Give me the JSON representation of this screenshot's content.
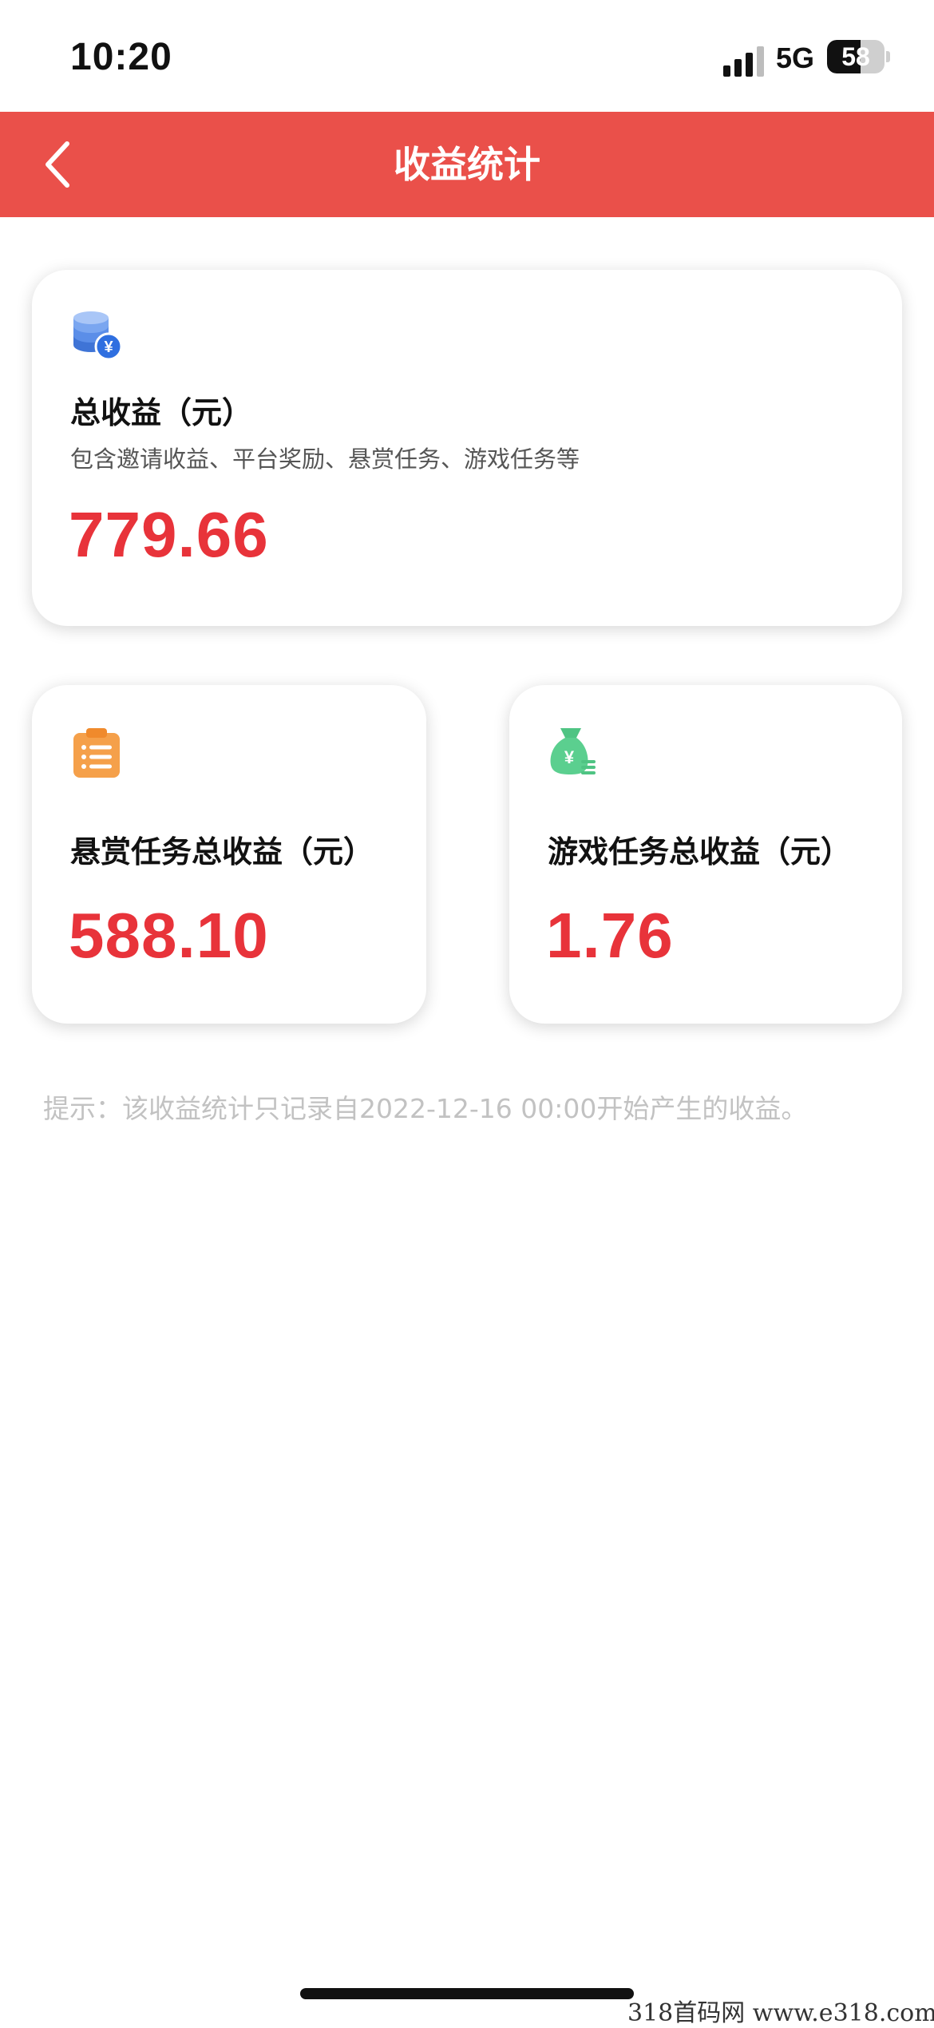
{
  "status_bar": {
    "time": "10:20",
    "network": "5G",
    "battery": "58",
    "battery_level": 0.58
  },
  "header": {
    "title": "收益统计",
    "back_icon": "chevron-left-icon"
  },
  "total_card": {
    "icon": "coin-stack-icon",
    "title": "总收益（元）",
    "description": "包含邀请收益、平台奖励、悬赏任务、游戏任务等",
    "value": "779.66"
  },
  "bounty_card": {
    "icon": "clipboard-list-icon",
    "title": "悬赏任务总收益（元）",
    "value": "588.10"
  },
  "game_card": {
    "icon": "money-bag-icon",
    "title": "游戏任务总收益（元）",
    "value": "1.76"
  },
  "tip": "提示：该收益统计只记录自2022-12-16 00:00开始产生的收益。",
  "watermark": "318首码网  www.e318.com",
  "colors": {
    "header_bg": "#ea504a",
    "value_red": "#e8333a",
    "tip_gray": "#c2c2c2",
    "coin_blue": "#4f86e8",
    "clipboard_orange": "#f5a04a",
    "bag_green": "#5bcf8f"
  }
}
